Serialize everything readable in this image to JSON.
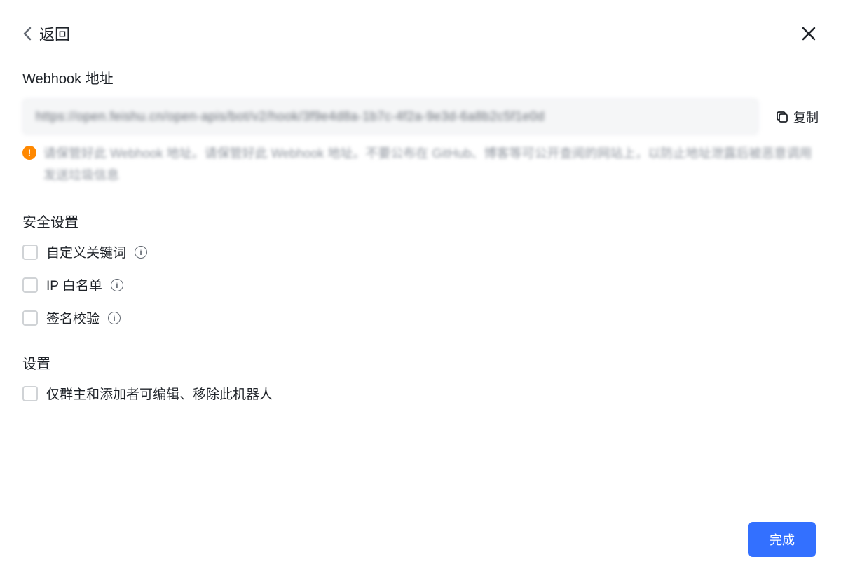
{
  "header": {
    "back_label": "返回"
  },
  "webhook": {
    "title": "Webhook 地址",
    "url": "https://open.feishu.cn/open-apis/bot/v2/hook/3f9e4d8a-1b7c-4f2a-9e3d-6a8b2c5f1e0d",
    "copy_label": "复制",
    "warning": "请保管好此 Webhook 地址。请保管好此 Webhook 地址。不要公布在 GitHub、博客等可公开查阅的网站上，以防止地址泄露后被恶意调用发送垃圾信息"
  },
  "security": {
    "title": "安全设置",
    "options": {
      "keywords": {
        "label": "自定义关键词"
      },
      "ip_allowlist": {
        "label": "IP 白名单"
      },
      "signature": {
        "label": "签名校验"
      }
    }
  },
  "settings": {
    "title": "设置",
    "only_owner_label": "仅群主和添加者可编辑、移除此机器人"
  },
  "footer": {
    "done_label": "完成"
  }
}
